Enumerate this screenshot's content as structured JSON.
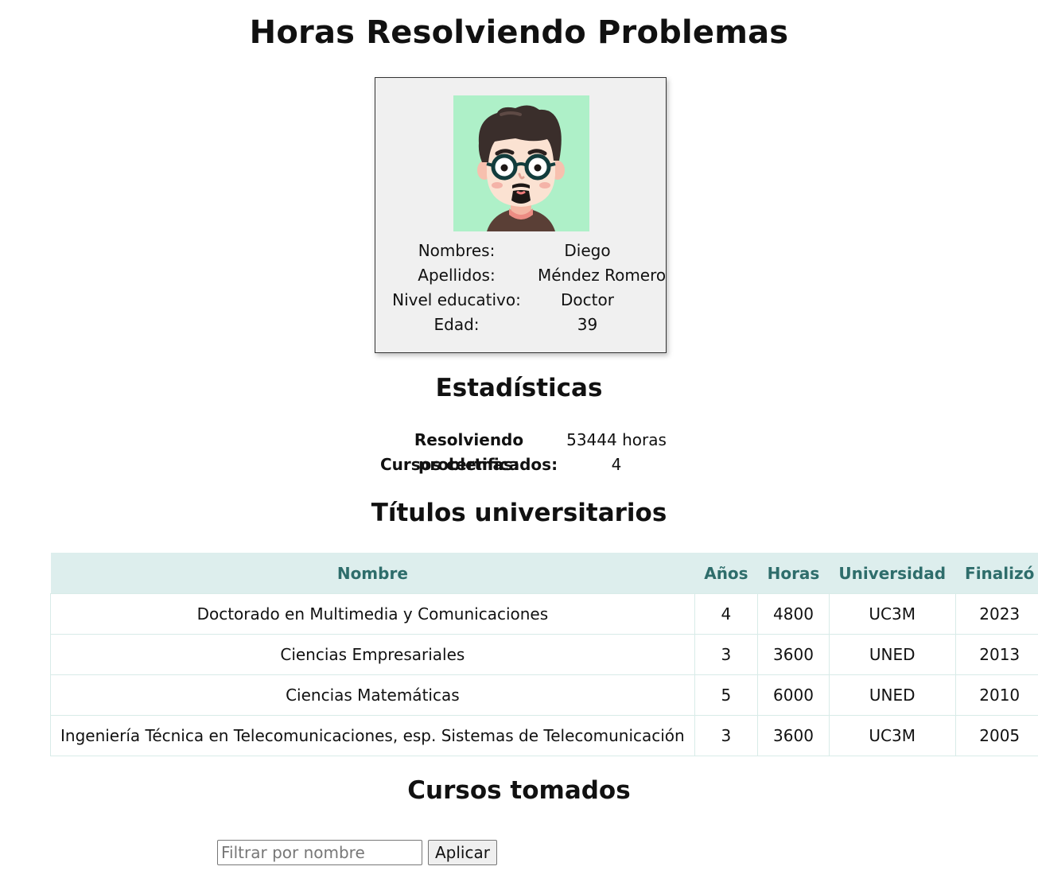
{
  "page": {
    "title": "Horas Resolviendo Problemas"
  },
  "profile": {
    "avatar_icon": "cartoon-man-with-glasses-avatar",
    "avatar_bg": "#aef0c8",
    "rows": [
      {
        "label": "Nombres:",
        "value": "Diego"
      },
      {
        "label": "Apellidos:",
        "value": "Méndez Romero"
      },
      {
        "label": "Nivel educativo:",
        "value": "Doctor"
      },
      {
        "label": "Edad:",
        "value": "39"
      }
    ]
  },
  "stats": {
    "heading": "Estadísticas",
    "rows": [
      {
        "label": "Resolviendo problemas:",
        "value": "53444 horas"
      },
      {
        "label": "Cursos certificados:",
        "value": "4"
      }
    ]
  },
  "degrees": {
    "heading": "Títulos universitarios",
    "columns": [
      "Nombre",
      "Años",
      "Horas",
      "Universidad",
      "Finalizó"
    ],
    "rows": [
      [
        "Doctorado en Multimedia y Comunicaciones",
        "4",
        "4800",
        "UC3M",
        "2023"
      ],
      [
        "Ciencias Empresariales",
        "3",
        "3600",
        "UNED",
        "2013"
      ],
      [
        "Ciencias Matemáticas",
        "5",
        "6000",
        "UNED",
        "2010"
      ],
      [
        "Ingeniería Técnica en Telecomunicaciones, esp. Sistemas de Telecomunicación",
        "3",
        "3600",
        "UC3M",
        "2005"
      ]
    ],
    "header_bg": "#ddeeed",
    "header_color": "#2e6d6b"
  },
  "courses": {
    "heading": "Cursos tomados",
    "filter_placeholder": "Filtrar por nombre",
    "filter_value": "",
    "apply_label": "Aplicar"
  }
}
